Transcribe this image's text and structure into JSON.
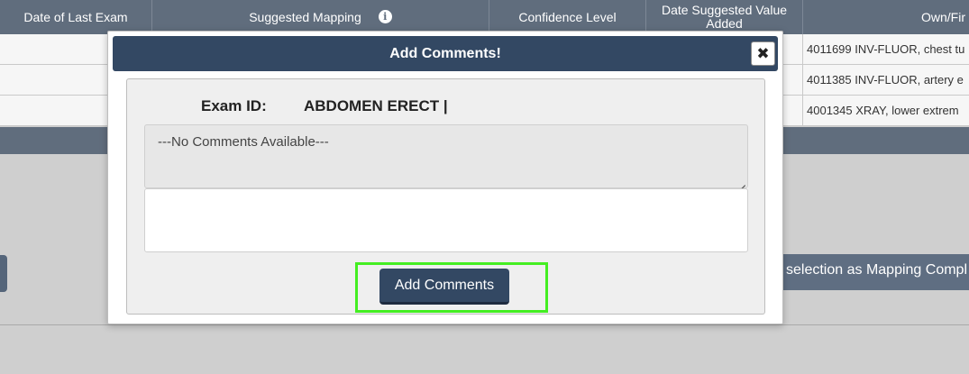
{
  "table": {
    "headers": [
      "Date of Last Exam",
      "Suggested Mapping",
      "Confidence Level",
      "Date Suggested Value Added",
      "Own/Fir"
    ],
    "rows": [
      {
        "last_col": "4011699 INV-FLUOR, chest tu"
      },
      {
        "last_col": "4011385 INV-FLUOR, artery e"
      },
      {
        "last_col": "4001345 XRAY, lower extrem"
      }
    ]
  },
  "mark_complete_label": "selection as Mapping Compl",
  "modal": {
    "title": "Add Comments!",
    "close_glyph": "✖",
    "exam_id_label": "Exam ID:",
    "exam_id_value": "ABDOMEN ERECT |",
    "existing_comments": "---No Comments Available---",
    "new_comment_value": "",
    "new_comment_placeholder": "",
    "submit_label": "Add Comments"
  },
  "icons": {
    "info": "info-icon",
    "close": "close-icon"
  },
  "colors": {
    "header_bg": "#606d7d",
    "modal_header_bg": "#334863",
    "highlight": "#44ee22"
  }
}
